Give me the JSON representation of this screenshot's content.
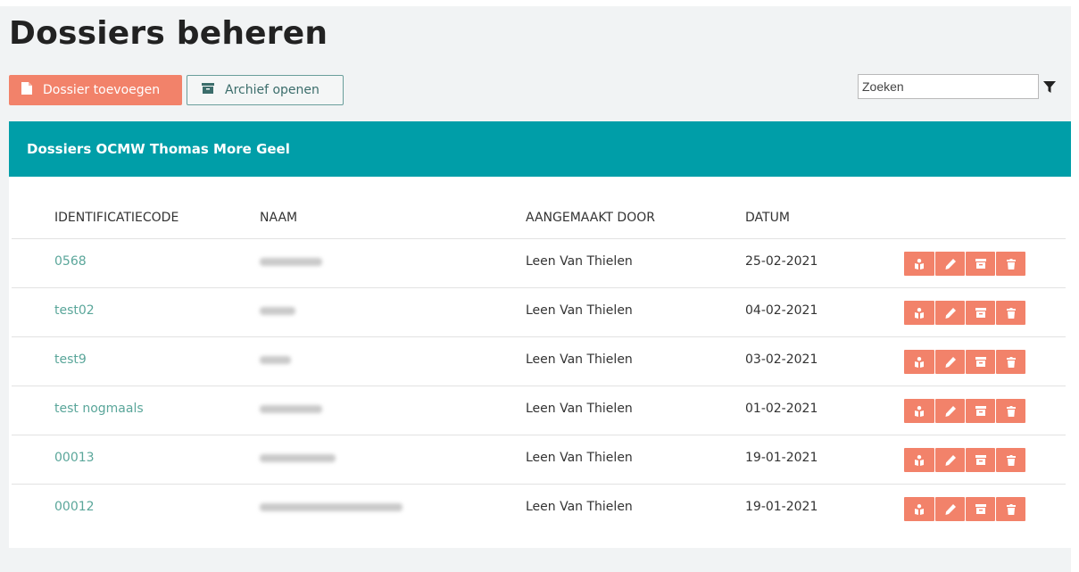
{
  "page": {
    "title": "Dossiers beheren"
  },
  "toolbar": {
    "add_label": "Dossier toevoegen",
    "add_icon": "file-icon",
    "archive_label": "Archief openen",
    "archive_icon": "archive-box-icon",
    "search_placeholder": "Zoeken",
    "filter_icon": "filter-icon"
  },
  "panel": {
    "header": "Dossiers OCMW Thomas More Geel"
  },
  "table": {
    "columns": [
      "IDENTIFICATIECODE",
      "NAAM",
      "AANGEMAAKT DOOR",
      "DATUM"
    ],
    "rows": [
      {
        "code": "0568",
        "created_by": "Leen Van Thielen",
        "date": "25-02-2021"
      },
      {
        "code": "test02",
        "created_by": "Leen Van Thielen",
        "date": "04-02-2021"
      },
      {
        "code": "test9",
        "created_by": "Leen Van Thielen",
        "date": "03-02-2021"
      },
      {
        "code": "test nogmaals",
        "created_by": "Leen Van Thielen",
        "date": "01-02-2021"
      },
      {
        "code": "00013",
        "created_by": "Leen Van Thielen",
        "date": "19-01-2021"
      },
      {
        "code": "00012",
        "created_by": "Leen Van Thielen",
        "date": "19-01-2021"
      }
    ],
    "row_actions": [
      "share-icon",
      "pencil-icon",
      "archive-icon",
      "trash-icon"
    ]
  },
  "colors": {
    "accent": "#f2826a",
    "header_bg": "#009ea8",
    "link": "#5aa69a",
    "secondary_border": "#6a9e9b",
    "page_bg": "#f1f3f4"
  }
}
